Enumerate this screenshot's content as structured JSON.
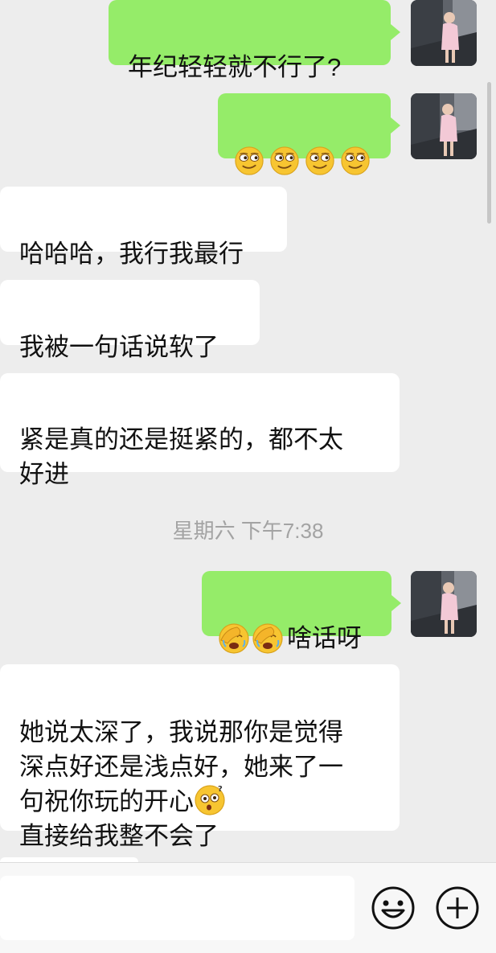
{
  "messages": [
    {
      "side": "right",
      "text": "年纪轻轻就不行了?"
    },
    {
      "side": "right",
      "emoji": [
        "smirk-emoji",
        "smirk-emoji",
        "smirk-emoji",
        "smirk-emoji"
      ]
    },
    {
      "side": "left",
      "text": "哈哈哈，我行我最行"
    },
    {
      "side": "left",
      "text": "我被一句话说软了"
    },
    {
      "side": "left",
      "text": "紧是真的还是挺紧的，都不太\n好进"
    },
    {
      "side": "right",
      "text": "啥话呀",
      "emoji": [
        "facepalm-emoji",
        "facepalm-emoji"
      ]
    },
    {
      "side": "left",
      "text_before": "她说太深了，我说那你是觉得\n深点好还是浅点好，她来了一\n句祝你玩的开心",
      "emoji": [
        "confused-emoji"
      ],
      "text_after": "\n直接给我整不会了"
    }
  ],
  "timestamp": "星期六 下午7:38",
  "colors": {
    "sent_bubble": "#95ec69",
    "received_bubble": "#ffffff",
    "background": "#ededed"
  },
  "input_bar": {
    "value": "",
    "icons": [
      "emoji-face-icon",
      "plus-icon"
    ]
  }
}
